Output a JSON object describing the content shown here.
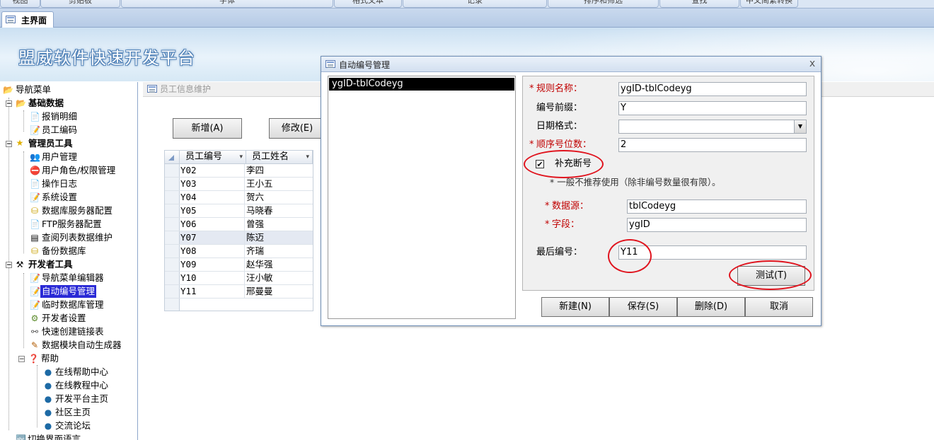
{
  "ribbon": {
    "groups": [
      "视图",
      "剪贴板",
      "字体",
      "格式文本",
      "记录",
      "排序和筛选",
      "查找",
      "中文简繁转换"
    ]
  },
  "main_tab": {
    "label": "主界面"
  },
  "banner": {
    "title": "盟威软件快速开发平台"
  },
  "nav": {
    "root": "导航菜单",
    "groups": [
      {
        "label": "基础数据",
        "items": [
          "报销明细",
          "员工编码"
        ]
      },
      {
        "label": "管理员工具",
        "items": [
          "用户管理",
          "用户角色/权限管理",
          "操作日志",
          "系统设置",
          "数据库服务器配置",
          "FTP服务器配置",
          "查阅列表数据维护",
          "备份数据库"
        ]
      },
      {
        "label": "开发者工具",
        "items": [
          "导航菜单编辑器",
          "自动编号管理",
          "临时数据库管理",
          "开发者设置",
          "快速创建链接表",
          "数据模块自动生成器"
        ]
      },
      {
        "label": "帮助",
        "items": [
          "在线帮助中心",
          "在线教程中心",
          "开发平台主页",
          "社区主页",
          "交流论坛"
        ]
      }
    ],
    "last_item": "切换界面语言",
    "selected": "自动编号管理"
  },
  "employee_form": {
    "title": "员工信息维护",
    "add_button": "新增(A)",
    "edit_button": "修改(E)",
    "columns": [
      "员工编号",
      "员工姓名"
    ],
    "rows": [
      [
        "Y02",
        "李四"
      ],
      [
        "Y03",
        "王小五"
      ],
      [
        "Y04",
        "贺六"
      ],
      [
        "Y05",
        "马晓春"
      ],
      [
        "Y06",
        "曾强"
      ],
      [
        "Y07",
        "陈迈"
      ],
      [
        "Y08",
        "齐瑞"
      ],
      [
        "Y09",
        "赵华强"
      ],
      [
        "Y10",
        "汪小敏"
      ],
      [
        "Y11",
        "邢曼曼"
      ]
    ]
  },
  "dialog": {
    "title": "自动编号管理",
    "close": "x",
    "rule_list": [
      "ygID-tblCodeyg"
    ],
    "fields": {
      "rule_name_label": "规则名称：",
      "rule_name": "ygID-tblCodeyg",
      "prefix_label": "编号前缀：",
      "prefix": "Y",
      "date_format_label": "日期格式：",
      "date_format": "",
      "seq_digits_label": "顺序号位数：",
      "seq_digits": "2",
      "fill_gaps_label": "补充断号",
      "fill_gaps_checked": true,
      "note": "* 一般不推荐使用（除非编号数量很有限）。",
      "datasource_label": "数据源：",
      "datasource": "tblCodeyg",
      "field_label": "字段：",
      "field": "ygID",
      "last_number_label": "最后编号：",
      "last_number": "Y11"
    },
    "req_mark": "*",
    "check_mark": "✔",
    "dropdown_arrow": "▼",
    "test_button": "测试(T)",
    "buttons": {
      "new": "新建(N)",
      "save": "保存(S)",
      "delete": "删除(D)",
      "cancel": "取消"
    }
  }
}
